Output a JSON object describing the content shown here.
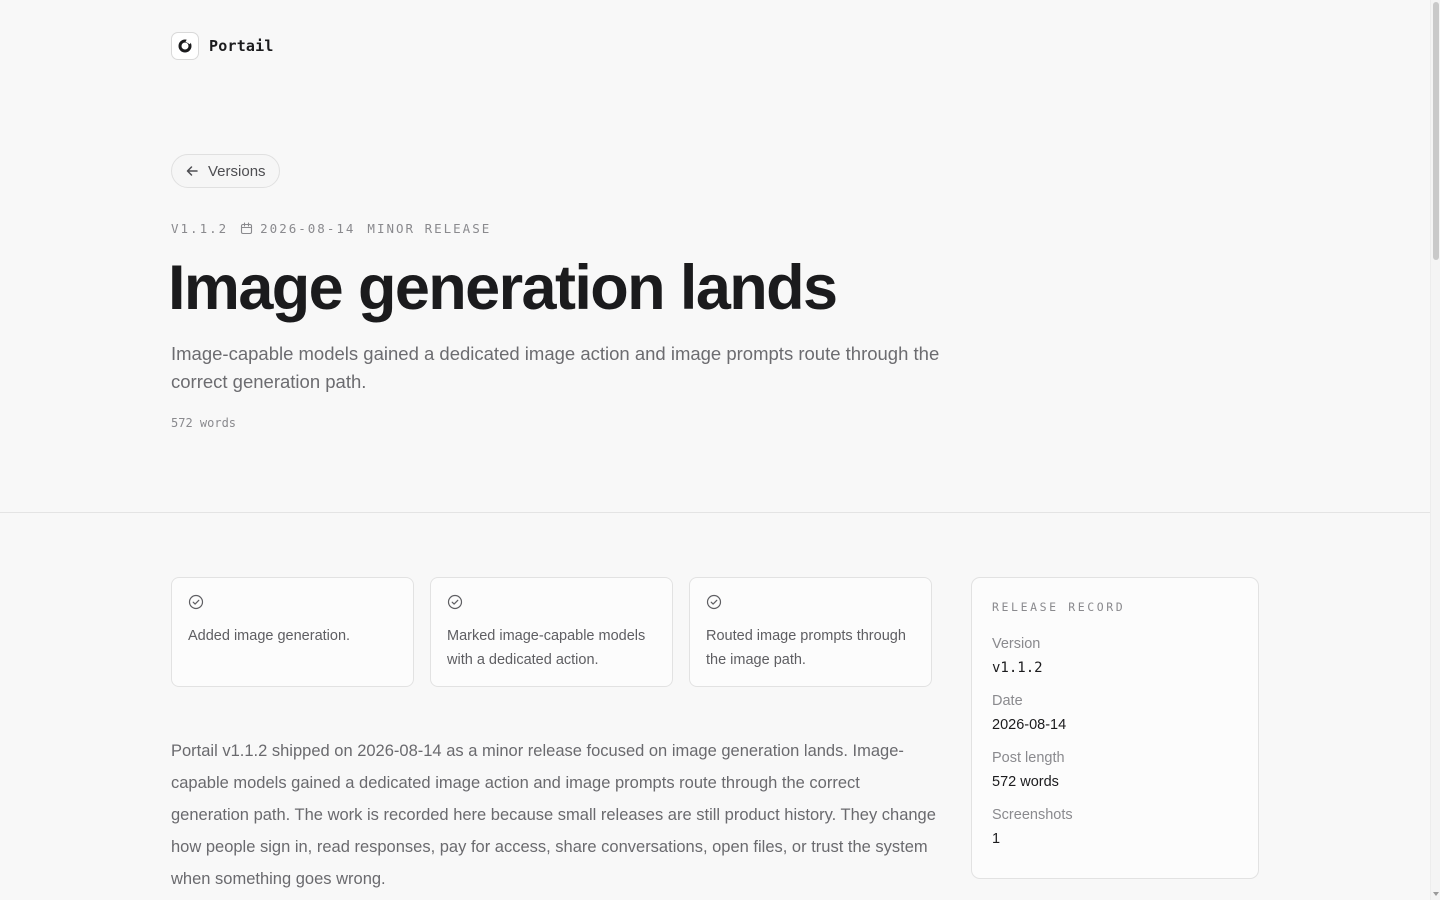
{
  "brand": {
    "name": "Portail",
    "icon": "portail-logo-icon"
  },
  "nav": {
    "back_label": "Versions",
    "back_icon": "arrow-left-icon"
  },
  "meta": {
    "version": "V1.1.2",
    "date_icon": "calendar-icon",
    "date": "2026-08-14",
    "release_type": "MINOR RELEASE"
  },
  "title": "Image generation lands",
  "subtitle": "Image-capable models gained a dedicated image action and image prompts route through the correct generation path.",
  "word_count": "572 words",
  "highlights": [
    {
      "icon": "check-circle-icon",
      "text": "Added image generation."
    },
    {
      "icon": "check-circle-icon",
      "text": "Marked image-capable models with a dedicated action."
    },
    {
      "icon": "check-circle-icon",
      "text": "Routed image prompts through the image path."
    }
  ],
  "body": "Portail v1.1.2 shipped on 2026-08-14 as a minor release focused on image generation lands. Image-capable models gained a dedicated image action and image prompts route through the correct generation path. The work is recorded here because small releases are still product history. They change how people sign in, read responses, pay for access, share conversations, open files, or trust the system when something goes wrong.",
  "record": {
    "heading": "RELEASE RECORD",
    "items": [
      {
        "label": "Version",
        "value": "v1.1.2"
      },
      {
        "label": "Date",
        "value": "2026-08-14"
      },
      {
        "label": "Post length",
        "value": "572 words"
      },
      {
        "label": "Screenshots",
        "value": "1"
      }
    ]
  },
  "colors": {
    "background": "#f8f8f8",
    "text": "#1b1b1d",
    "muted": "#8a8a8e",
    "border": "#e2e2e2"
  }
}
